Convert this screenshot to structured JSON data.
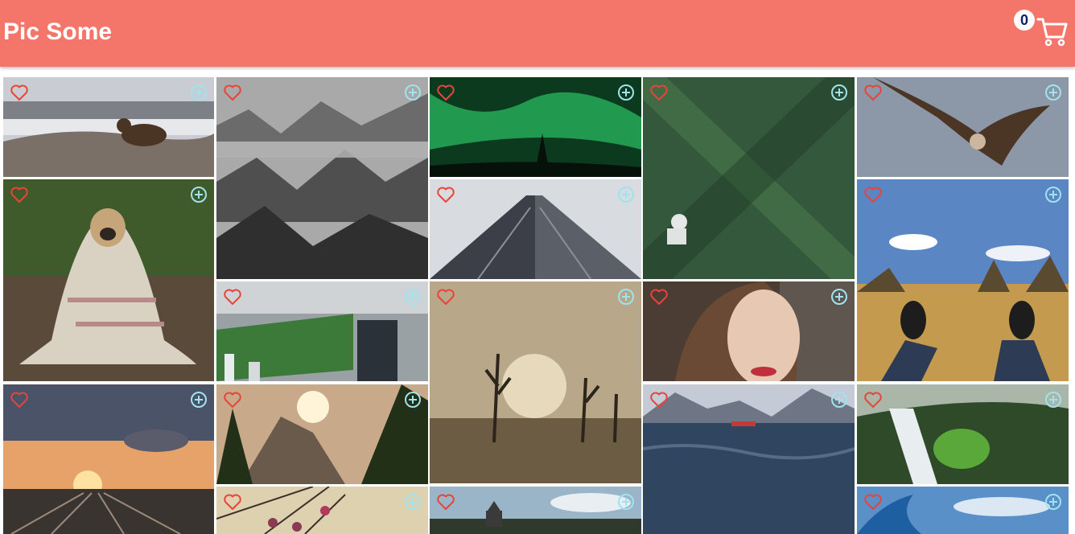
{
  "header": {
    "title": "Pic Some",
    "cart_count": "0",
    "cart_icon": "cart-icon",
    "background": "#f4766b"
  },
  "tile_icons": {
    "favorite": "heart-outline-icon",
    "add_to_cart": "add-circle-outline-icon",
    "heart_color": "#e8443a",
    "plus_color": "#9fe3ee"
  },
  "photos": [
    {
      "id": "bear-on-rocks",
      "icon": "bear-photo"
    },
    {
      "id": "foggy-forest",
      "icon": "forest-fog-photo"
    },
    {
      "id": "northern-lights",
      "icon": "aurora-photo"
    },
    {
      "id": "mountain-biker-forest",
      "icon": "biker-photo"
    },
    {
      "id": "vulture-flying",
      "icon": "vulture-photo"
    },
    {
      "id": "pug-in-blanket",
      "icon": "pug-photo"
    },
    {
      "id": "skyscraper-from-below",
      "icon": "skyscraper-photo"
    },
    {
      "id": "feet-on-meadow",
      "icon": "meadow-photo"
    },
    {
      "id": "central-park-aerial",
      "icon": "city-park-photo"
    },
    {
      "id": "dead-trees-sunset",
      "icon": "dead-trees-photo"
    },
    {
      "id": "woman-portrait",
      "icon": "portrait-photo"
    },
    {
      "id": "railway-sunset",
      "icon": "railway-photo"
    },
    {
      "id": "mountain-sunrise",
      "icon": "mountain-photo"
    },
    {
      "id": "fjord-with-boat",
      "icon": "fjord-photo"
    },
    {
      "id": "waterfall-gorge",
      "icon": "waterfall-photo"
    },
    {
      "id": "sculpture-spheres",
      "icon": "sculpture-photo"
    },
    {
      "id": "castle-landscape",
      "icon": "castle-photo"
    },
    {
      "id": "ocean-wave-sky",
      "icon": "wave-photo"
    }
  ]
}
